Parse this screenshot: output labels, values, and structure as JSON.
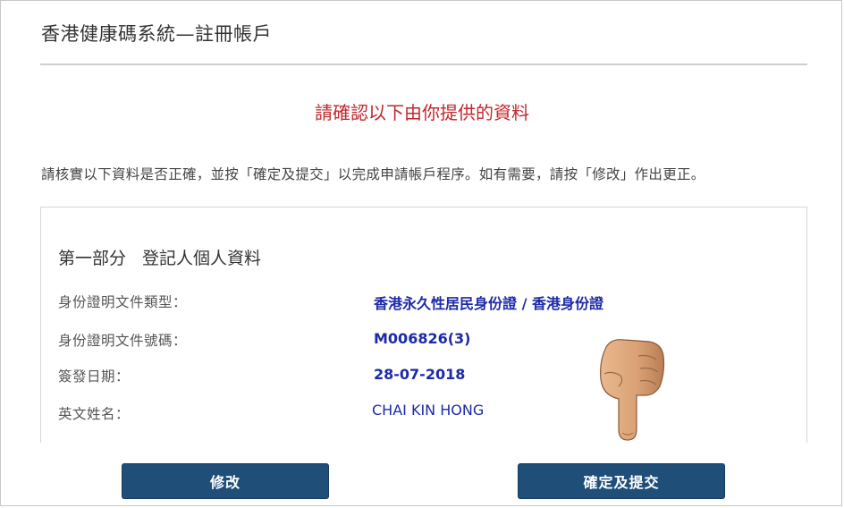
{
  "header": {
    "title": "香港健康碼系統—註冊帳戶"
  },
  "confirm": {
    "heading": "請確認以下由你提供的資料",
    "instruction": "請核實以下資料是否正確，並按「確定及提交」以完成申請帳戶程序。如有需要，請按「修改」作出更正。"
  },
  "section1": {
    "part": "第一部分",
    "title": "登記人個人資料",
    "rows": [
      {
        "label": "身份證明文件類型：",
        "value": "香港永久性居民身份證 / 香港身份證"
      },
      {
        "label": "身份證明文件號碼：",
        "value": "M006826(3)"
      },
      {
        "label": "簽發日期：",
        "value": "28-07-2018"
      },
      {
        "label": "英文姓名：",
        "value": "CHAI KIN HONG"
      }
    ]
  },
  "actions": {
    "edit_label": "修改",
    "submit_label": "確定及提交"
  },
  "colors": {
    "heading_red": "#c1272d",
    "value_blue": "#1d2aa8",
    "button_bg": "#1f4e79"
  },
  "icons": {
    "pointer": "pointing-hand-icon"
  }
}
